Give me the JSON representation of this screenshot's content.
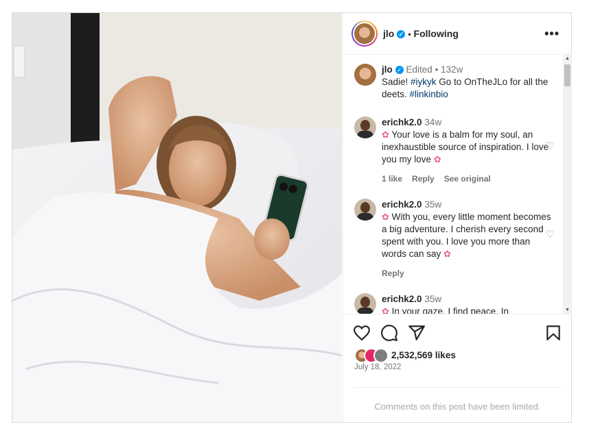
{
  "header": {
    "username": "jlo",
    "separator": "•",
    "following_label": "Following",
    "more_label": "•••"
  },
  "caption": {
    "username": "jlo",
    "edited_label": "Edited",
    "separator": "•",
    "age": "132w",
    "text_start": "Sadie! ",
    "hashtag1": "#iykyk",
    "text_mid": " Go to OnTheJLo for all the deets. ",
    "hashtag2": "#linkinbio"
  },
  "comments": [
    {
      "username": "erichk2.0",
      "age": "34w",
      "text": " Your love is a balm for my soul, an inexhaustible source of inspiration. I love you my love ",
      "likes": "1 like",
      "reply_label": "Reply",
      "see_original": "See original"
    },
    {
      "username": "erichk2.0",
      "age": "35w",
      "text": " With you, every little moment becomes a big adventure. I cherish every second spent with you. I love you more than words can say ",
      "reply_label": "Reply"
    },
    {
      "username": "erichk2.0",
      "age": "35w",
      "text": " In your gaze, I find peace. In"
    }
  ],
  "likes": {
    "count_text": "2,532,569 likes"
  },
  "date": "July 18, 2022",
  "limited_notice": "Comments on this post have been limited.",
  "icons": {
    "flower": "✿",
    "heart": "♡",
    "verified": "✓",
    "scroll_up": "▲",
    "scroll_down": "▼"
  },
  "colors": {
    "link": "#00376b",
    "verified": "#0095f6",
    "muted": "#737373",
    "flower": "#e85f9b"
  }
}
